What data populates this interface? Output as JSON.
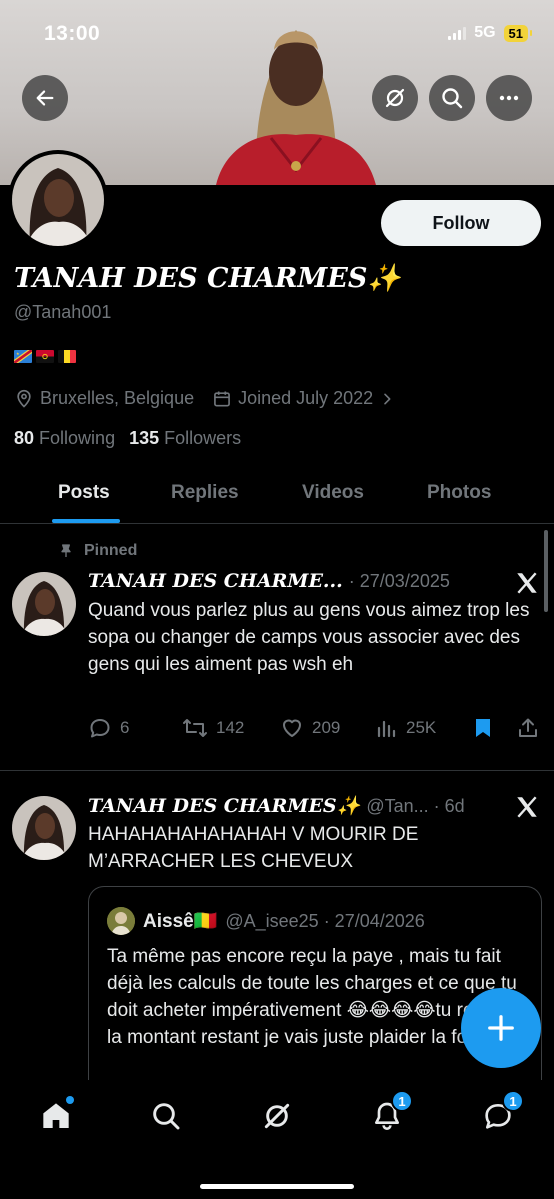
{
  "status_bar": {
    "time": "13:00",
    "network": "5G",
    "battery": "51"
  },
  "header": {
    "back_icon": "arrow-left-icon",
    "grok_icon": "grok-icon",
    "search_icon": "search-icon",
    "more_icon": "more-icon"
  },
  "profile": {
    "display_name": "TANAH DES CHARMES✨",
    "handle": "@Tanah001",
    "follow_label": "Follow",
    "flags": [
      "DR Congo",
      "Angola",
      "Belgium"
    ],
    "location": "Bruxelles, Belgique",
    "joined": "Joined July 2022",
    "following_count": "80",
    "following_label": "Following",
    "followers_count": "135",
    "followers_label": "Followers"
  },
  "tabs": [
    {
      "label": "Posts",
      "active": true
    },
    {
      "label": "Replies",
      "active": false
    },
    {
      "label": "Videos",
      "active": false
    },
    {
      "label": "Photos",
      "active": false
    }
  ],
  "posts": [
    {
      "pinned_label": "Pinned",
      "name": "TANAH DES CHARME...",
      "meta": "· 27/03/2025",
      "text": "Quand vous parlez plus au gens vous aimez trop les sopa ou changer de camps vous associer avec des gens qui les aiment pas wsh eh",
      "replies": "6",
      "reposts": "142",
      "likes": "209",
      "views": "25K"
    },
    {
      "name": "TANAH DES CHARMES✨",
      "meta": "@Tan... · 6d",
      "text": "HAHAHAHAHAHAHAH V MOURIR DE M’ARRACHER LES CHEVEUX",
      "quote": {
        "name": "Aissê🇲🇱",
        "meta": "@A_isee25 · 27/04/2026",
        "text": "Ta même pas encore reçu la paye , mais tu fait déjà les calculs de toute les charges et ce que tu doit acheter impérativement 😂😂😂😂tu regarde la montant restant je vais juste plaider la folie"
      }
    }
  ],
  "bottom_nav": {
    "items": [
      "home-icon",
      "search-icon",
      "grok-icon",
      "notifications-icon",
      "messages-icon"
    ],
    "notifications_badge": "1",
    "messages_badge": "1"
  },
  "colors": {
    "accent": "#1d9bf0",
    "muted": "#71767b",
    "text": "#e7e9ea",
    "background": "#000000"
  }
}
